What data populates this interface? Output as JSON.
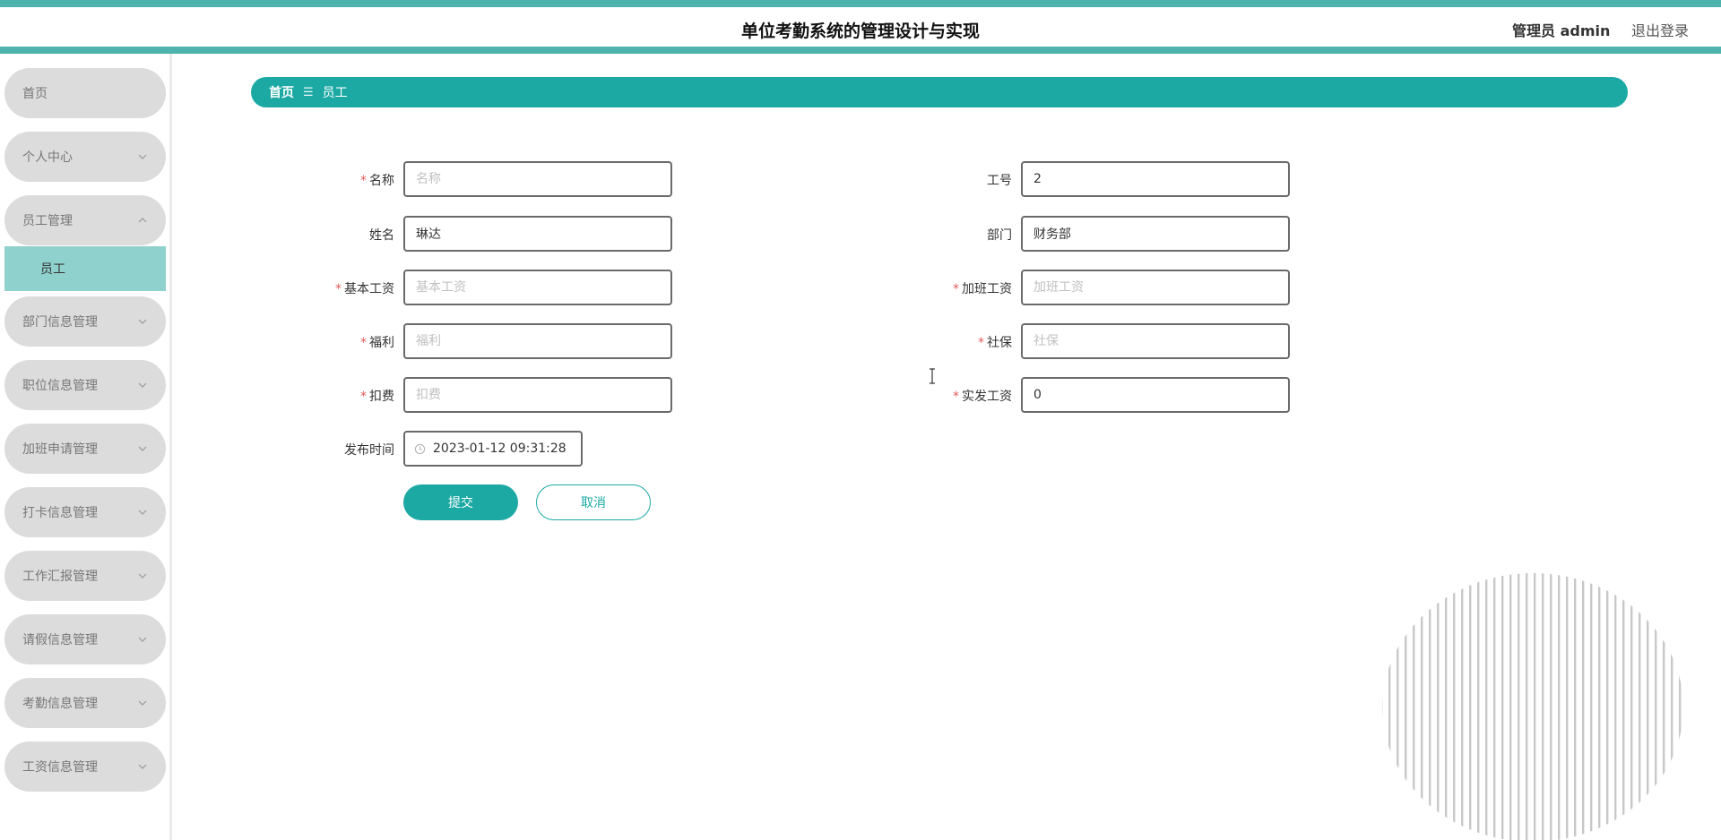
{
  "header": {
    "title": "单位考勤系统的管理设计与实现",
    "user_label": "管理员 admin",
    "logout_label": "退出登录"
  },
  "sidebar": {
    "items": [
      {
        "label": "首页",
        "chevron": "none"
      },
      {
        "label": "个人中心",
        "chevron": "down"
      },
      {
        "label": "员工管理",
        "chevron": "up",
        "expanded": true,
        "children": [
          {
            "label": "员工",
            "active": true
          }
        ]
      },
      {
        "label": "部门信息管理",
        "chevron": "down"
      },
      {
        "label": "职位信息管理",
        "chevron": "down"
      },
      {
        "label": "加班申请管理",
        "chevron": "down"
      },
      {
        "label": "打卡信息管理",
        "chevron": "down"
      },
      {
        "label": "工作汇报管理",
        "chevron": "down"
      },
      {
        "label": "请假信息管理",
        "chevron": "down"
      },
      {
        "label": "考勤信息管理",
        "chevron": "down"
      },
      {
        "label": "工资信息管理",
        "chevron": "down"
      }
    ]
  },
  "breadcrumb": {
    "home": "首页",
    "separator": "☰",
    "current": "员工"
  },
  "form": {
    "left_fields": [
      {
        "label": "名称",
        "required": true,
        "value": "",
        "placeholder": "名称"
      },
      {
        "label": "姓名",
        "required": false,
        "value": "琳达",
        "placeholder": "姓名"
      },
      {
        "label": "基本工资",
        "required": true,
        "value": "",
        "placeholder": "基本工资"
      },
      {
        "label": "福利",
        "required": true,
        "value": "",
        "placeholder": "福利"
      },
      {
        "label": "扣费",
        "required": true,
        "value": "",
        "placeholder": "扣费"
      }
    ],
    "right_fields": [
      {
        "label": "工号",
        "required": false,
        "value": "2",
        "placeholder": "工号"
      },
      {
        "label": "部门",
        "required": false,
        "value": "财务部",
        "placeholder": "部门"
      },
      {
        "label": "加班工资",
        "required": true,
        "value": "",
        "placeholder": "加班工资"
      },
      {
        "label": "社保",
        "required": true,
        "value": "",
        "placeholder": "社保"
      },
      {
        "label": "实发工资",
        "required": true,
        "value": "0",
        "placeholder": "实发工资"
      }
    ],
    "publish_time": {
      "label": "发布时间",
      "value": "2023-01-12 09:31:28"
    },
    "required_mark": "*",
    "submit_label": "提交",
    "cancel_label": "取消"
  },
  "colors": {
    "accent": "#1ca9a4",
    "header_strip": "#4db3ac",
    "menu_bg": "#dcdcdc",
    "submenu_active": "#8fd1cd",
    "required": "#e25b5b"
  },
  "icons": {
    "chevron": "chevron-icon",
    "clock": "clock-icon",
    "text_cursor": "text-cursor-icon"
  }
}
